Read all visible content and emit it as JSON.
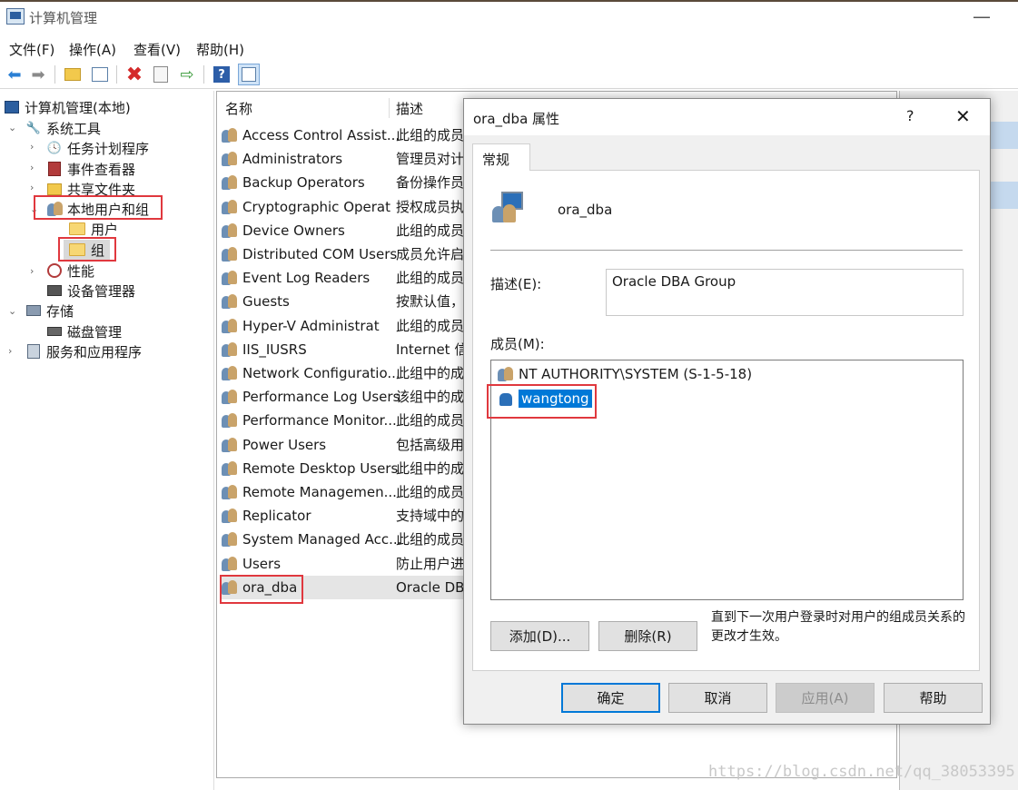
{
  "window": {
    "title": "计算机管理",
    "minimize_glyph": "—"
  },
  "menu": [
    "文件(F)",
    "操作(A)",
    "查看(V)",
    "帮助(H)"
  ],
  "toolbar": {
    "icons": [
      "back-arrow-icon",
      "forward-arrow-icon",
      "up-folder-icon",
      "show-hide-tree-icon",
      "delete-icon",
      "properties-icon",
      "export-icon",
      "help-icon",
      "show-hide-action-icon"
    ]
  },
  "tree": {
    "root": "计算机管理(本地)",
    "system_tools": "系统工具",
    "task_scheduler": "任务计划程序",
    "event_viewer": "事件查看器",
    "shared_folders": "共享文件夹",
    "local_users_groups": "本地用户和组",
    "users": "用户",
    "groups": "组",
    "performance": "性能",
    "device_manager": "设备管理器",
    "storage": "存储",
    "disk_management": "磁盘管理",
    "services_apps": "服务和应用程序"
  },
  "list": {
    "col_name": "名称",
    "col_desc": "描述",
    "rows": [
      {
        "name": "Access Control Assist...",
        "desc": "此组的成员"
      },
      {
        "name": "Administrators",
        "desc": "管理员对计"
      },
      {
        "name": "Backup Operators",
        "desc": "备份操作员"
      },
      {
        "name": "Cryptographic Operat",
        "desc": "授权成员执"
      },
      {
        "name": "Device Owners",
        "desc": "此组的成员"
      },
      {
        "name": "Distributed COM Users",
        "desc": "成员允许启"
      },
      {
        "name": "Event Log Readers",
        "desc": "此组的成员"
      },
      {
        "name": "Guests",
        "desc": "按默认值，"
      },
      {
        "name": "Hyper-V Administrat",
        "desc": "此组的成员"
      },
      {
        "name": "IIS_IUSRS",
        "desc": "Internet 信"
      },
      {
        "name": "Network Configuratio...",
        "desc": "此组中的成"
      },
      {
        "name": "Performance Log Users",
        "desc": "该组中的成"
      },
      {
        "name": "Performance Monitor...",
        "desc": "此组的成员"
      },
      {
        "name": "Power Users",
        "desc": "包括高级用"
      },
      {
        "name": "Remote Desktop Users",
        "desc": "此组中的成"
      },
      {
        "name": "Remote Managemen...",
        "desc": "此组的成员"
      },
      {
        "name": "Replicator",
        "desc": "支持域中的"
      },
      {
        "name": "System Managed Acc...",
        "desc": "此组的成员"
      },
      {
        "name": "Users",
        "desc": "防止用户进"
      },
      {
        "name": "ora_dba",
        "desc": "Oracle DBA"
      }
    ]
  },
  "dialog": {
    "title": "ora_dba 属性",
    "help_glyph": "?",
    "close_glyph": "✕",
    "tab_general": "常规",
    "group_name": "ora_dba",
    "desc_label": "描述(E):",
    "desc_value": "Oracle DBA Group",
    "members_label": "成员(M):",
    "members": [
      "NT AUTHORITY\\SYSTEM (S-1-5-18)",
      "wangtong"
    ],
    "add_button": "添加(D)...",
    "remove_button": "删除(R)",
    "note": "直到下一次用户登录时对用户的组成员关系的更改才生效。",
    "ok_button": "确定",
    "cancel_button": "取消",
    "apply_button": "应用(A)",
    "help_button": "帮助"
  },
  "watermark": "https://blog.csdn.net/qq_38053395",
  "colors": {
    "highlight_box": "#e0383e",
    "selection": "#0078d7",
    "primary_border": "#0078d7"
  }
}
